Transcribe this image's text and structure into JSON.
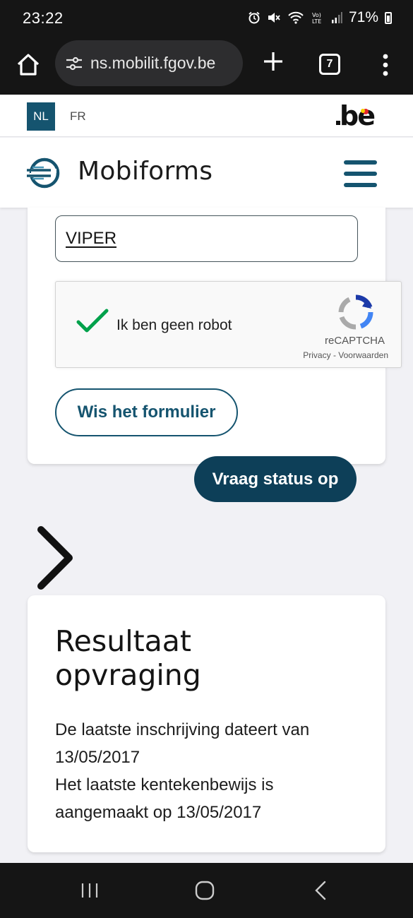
{
  "status_bar": {
    "time": "23:22",
    "battery": "71%",
    "icons": [
      "alarm-icon",
      "mute-icon",
      "wifi-icon",
      "volte-icon",
      "signal-icon",
      "battery-icon"
    ]
  },
  "browser": {
    "url": "ns.mobilit.fgov.be",
    "tab_count": "7"
  },
  "language": {
    "active": "NL",
    "other": "FR",
    "logo_text": ".be"
  },
  "header": {
    "title": "Mobiforms"
  },
  "form": {
    "plate_value": "VIPER",
    "recaptcha_label": "Ik ben geen robot",
    "recaptcha_brand": "reCAPTCHA",
    "recaptcha_links": "Privacy - Voorwaarden",
    "clear_label": "Wis het formulier",
    "submit_label": "Vraag status op"
  },
  "result": {
    "title": "Resultaat opvraging",
    "line1": "De laatste inschrijving dateert van 13/05/2017",
    "line2": "Het laatste kentekenbewijs is aangemaakt op 13/05/2017"
  },
  "colors": {
    "primary": "#15546f",
    "primary_dark": "#0d3f58",
    "recaptcha_check": "#00a14b",
    "page_background": "#f1f1f5"
  }
}
